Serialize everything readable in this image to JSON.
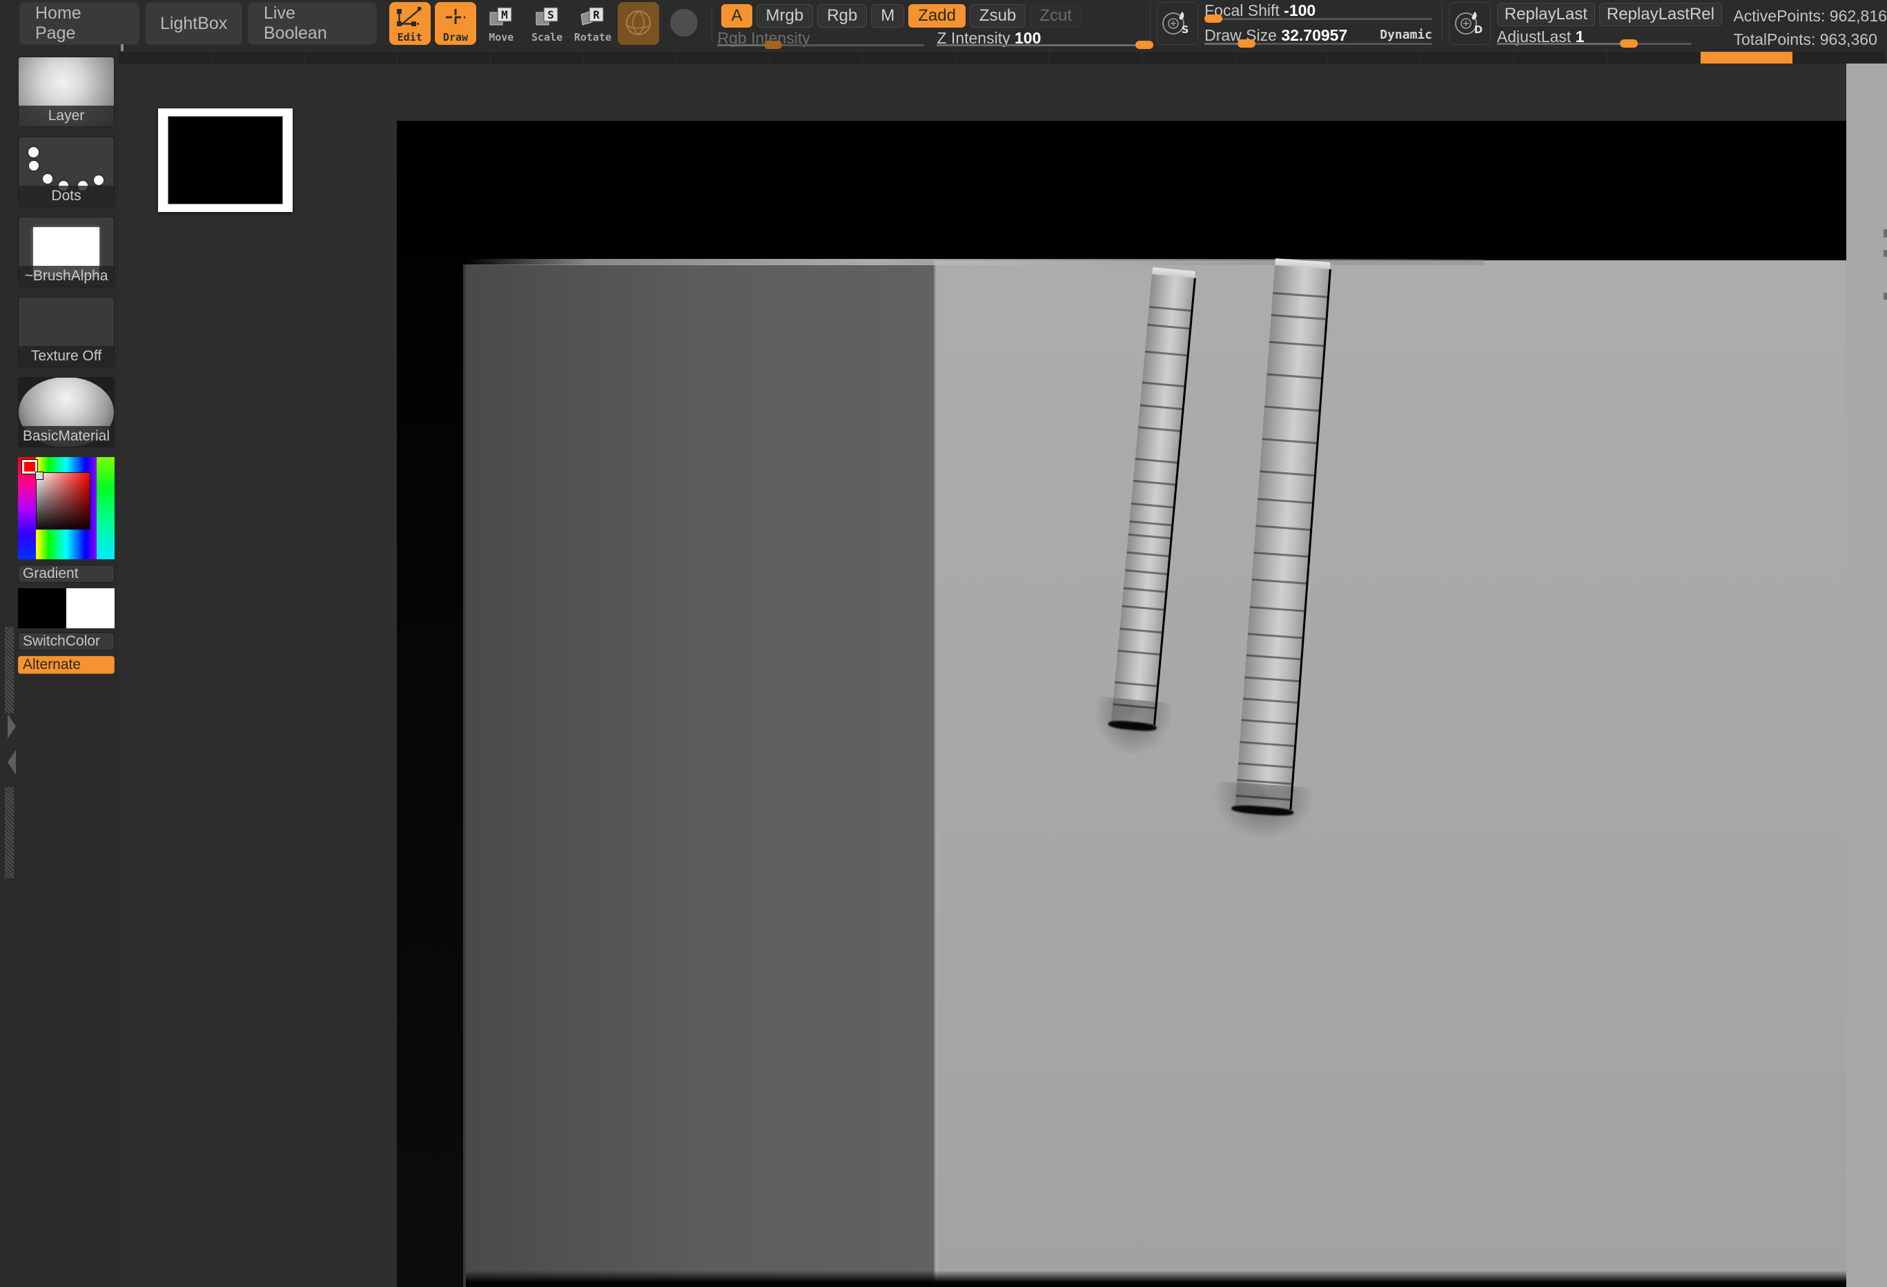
{
  "app": {
    "name": "ZBrush",
    "theme_accent": "#f4932f",
    "panel_bg": "#2b2b2b"
  },
  "menubar": {
    "items": [
      {
        "label": "Home Page",
        "name": "home-page"
      },
      {
        "label": "LightBox",
        "name": "lightbox"
      },
      {
        "label": "Live Boolean",
        "name": "live-boolean"
      }
    ]
  },
  "tools": [
    {
      "label": "Edit",
      "icon": "edit-transform-icon",
      "active": true
    },
    {
      "label": "Draw",
      "icon": "draw-crosshair-icon",
      "active": true
    },
    {
      "label": "Move",
      "icon": "move-m-icon",
      "active": false
    },
    {
      "label": "Scale",
      "icon": "scale-s-icon",
      "active": false
    },
    {
      "label": "Rotate",
      "icon": "rotate-r-icon",
      "active": false
    },
    {
      "label": "",
      "icon": "perspective-icon",
      "active": false,
      "style": "brown"
    },
    {
      "label": "",
      "icon": "floor-grid-icon",
      "active": false,
      "style": "plain"
    }
  ],
  "draw_modes": [
    {
      "label": "A",
      "state": "on"
    },
    {
      "label": "Mrgb",
      "state": "off"
    },
    {
      "label": "Rgb",
      "state": "off"
    },
    {
      "label": "M",
      "state": "off"
    },
    {
      "label": "Zadd",
      "state": "on"
    },
    {
      "label": "Zsub",
      "state": "off"
    },
    {
      "label": "Zcut",
      "state": "disabled"
    }
  ],
  "sliders": {
    "rgb_intensity": {
      "label": "Rgb Intensity",
      "value": "",
      "percent": 26,
      "disabled": true
    },
    "z_intensity": {
      "label": "Z Intensity",
      "value": "100",
      "percent": 100
    },
    "focal_shift": {
      "label": "Focal Shift",
      "value": "-100",
      "percent": 2
    },
    "draw_size": {
      "label": "Draw Size",
      "value": "32.70957",
      "percent": 18,
      "badge": "Dynamic"
    },
    "adjust_last": {
      "label": "AdjustLast",
      "value": "1",
      "percent": 68
    }
  },
  "stroke_buttons": [
    {
      "label": "ReplayLast",
      "name": "replay-last"
    },
    {
      "label": "ReplayLastRel",
      "name": "replay-last-rel"
    }
  ],
  "stats": {
    "active_points": "ActivePoints: 962,816",
    "total_points": "TotalPoints: 963,360"
  },
  "timeline": {
    "segments": 19,
    "active_index": 17
  },
  "shelf": {
    "items": [
      {
        "label": "Layer",
        "icon": "layer-brush-icon",
        "name": "brush-selector"
      },
      {
        "label": "Dots",
        "icon": "dots-stroke-icon",
        "name": "stroke-selector"
      },
      {
        "label": "~BrushAlpha",
        "icon": "brush-alpha-icon",
        "name": "alpha-selector"
      },
      {
        "label": "Texture Off",
        "icon": "texture-off-icon",
        "name": "texture-selector"
      },
      {
        "label": "BasicMaterial",
        "icon": "material-sphere-icon",
        "name": "material-selector"
      }
    ],
    "color_picker": {
      "name": "color-picker",
      "selected_hex": "#ff0000"
    },
    "gradient_label": "Gradient",
    "switch_color_label": "SwitchColor",
    "alternate_label": "Alternate",
    "primary_color": "#000000",
    "secondary_color": "#ffffff"
  },
  "canvas": {
    "document_thumb": {
      "name": "document-thumbnail",
      "outer": "#ffffff",
      "inner": "#000000"
    },
    "viewport_bg": "#000000",
    "plane_left_color": "#5c5c5c",
    "plane_right_color": "#a8a8a8",
    "objects": [
      {
        "name": "sculpt-strip-left",
        "note": "thin vertical sculpted strip"
      },
      {
        "name": "sculpt-strip-right",
        "note": "thin vertical sculpted strip"
      }
    ]
  }
}
